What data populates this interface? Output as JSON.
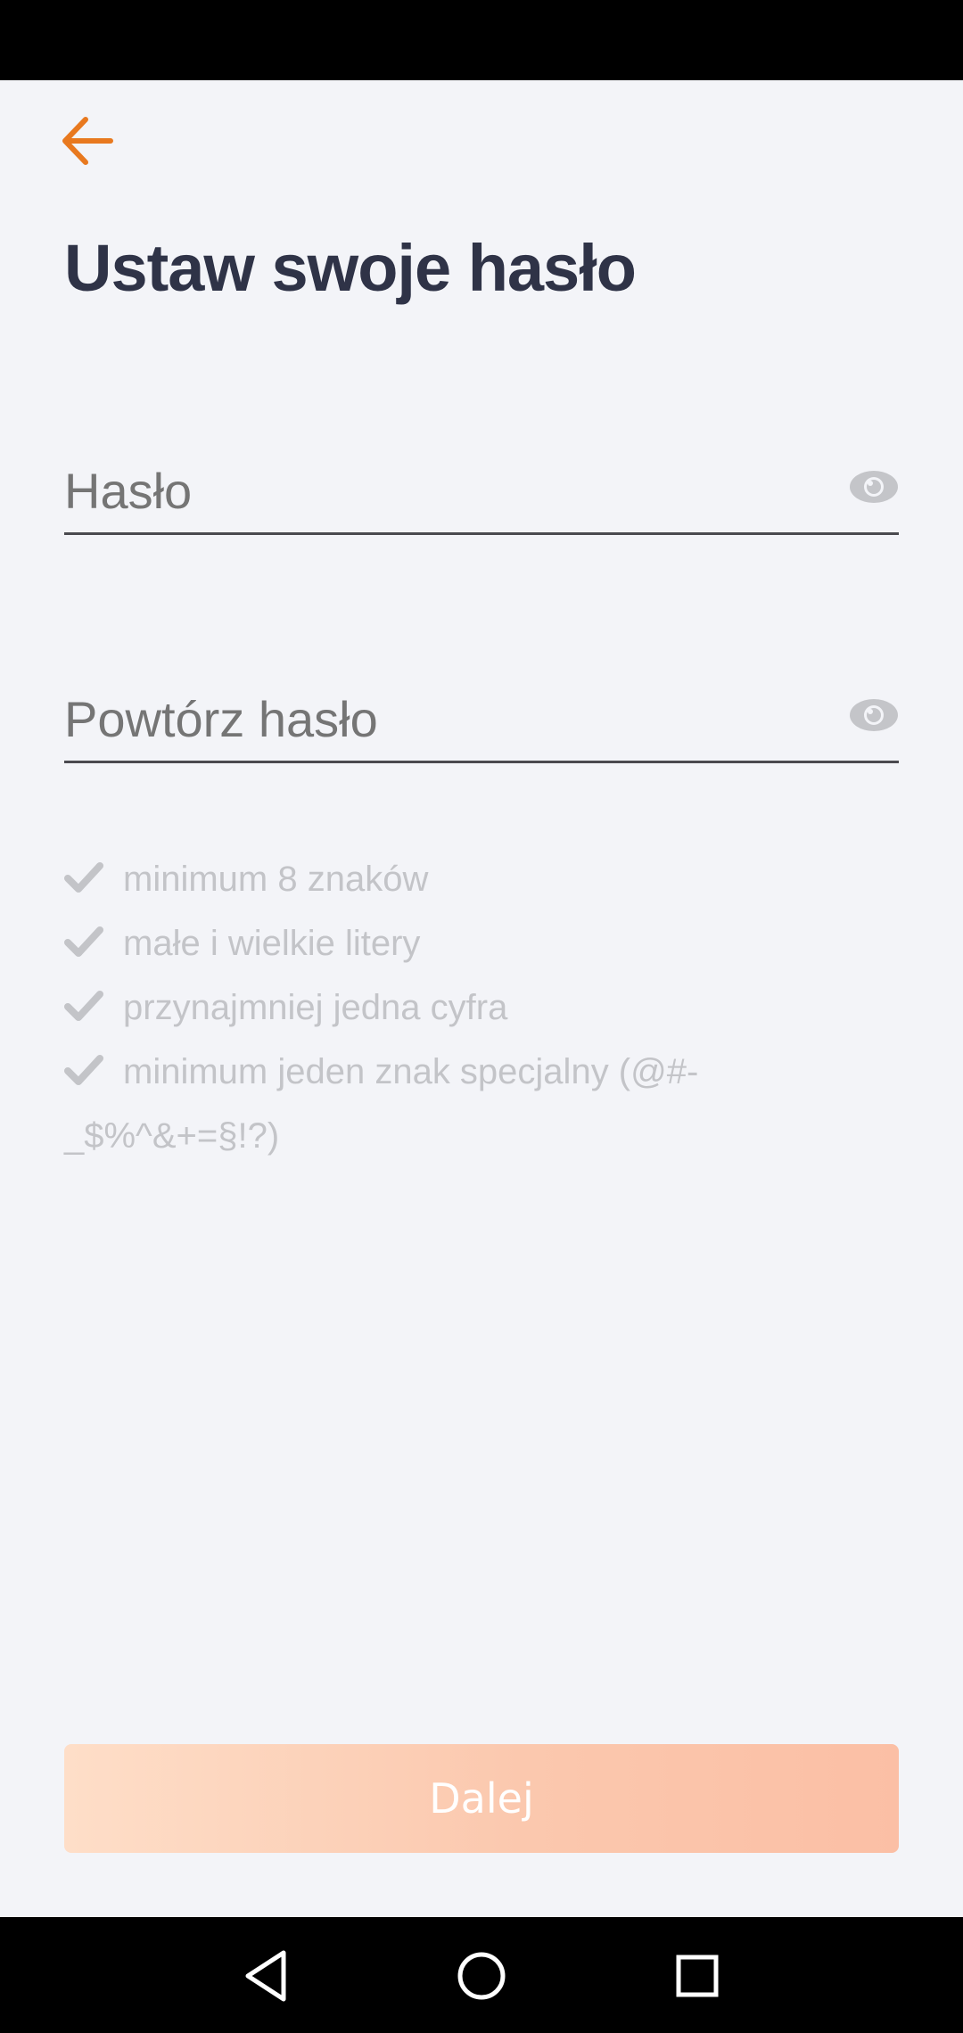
{
  "header": {
    "back_icon": "arrow-left-icon",
    "title": "Ustaw swoje hasło"
  },
  "form": {
    "password": {
      "placeholder": "Hasło",
      "value": "",
      "toggle_icon": "eye-icon"
    },
    "repeat_password": {
      "placeholder": "Powtórz hasło",
      "value": "",
      "toggle_icon": "eye-icon"
    }
  },
  "rules": [
    {
      "icon": "check-icon",
      "text": "minimum 8 znaków"
    },
    {
      "icon": "check-icon",
      "text": "małe i wielkie litery"
    },
    {
      "icon": "check-icon",
      "text": "przynajmniej jedna cyfra"
    },
    {
      "icon": "check-icon",
      "text": "minimum jeden znak specjalny (@#-_$%^&+=§!?)"
    }
  ],
  "action": {
    "label": "Dalej"
  },
  "colors": {
    "accent": "#e8791f",
    "title": "#2f3347",
    "rule_text": "#c3c4c8",
    "button_gradient_start": "#fedec8",
    "button_gradient_end": "#fbbfa5",
    "background": "#f3f4f8"
  },
  "system_nav": {
    "back_icon": "triangle-back-icon",
    "home_icon": "circle-home-icon",
    "recents_icon": "square-recents-icon"
  }
}
